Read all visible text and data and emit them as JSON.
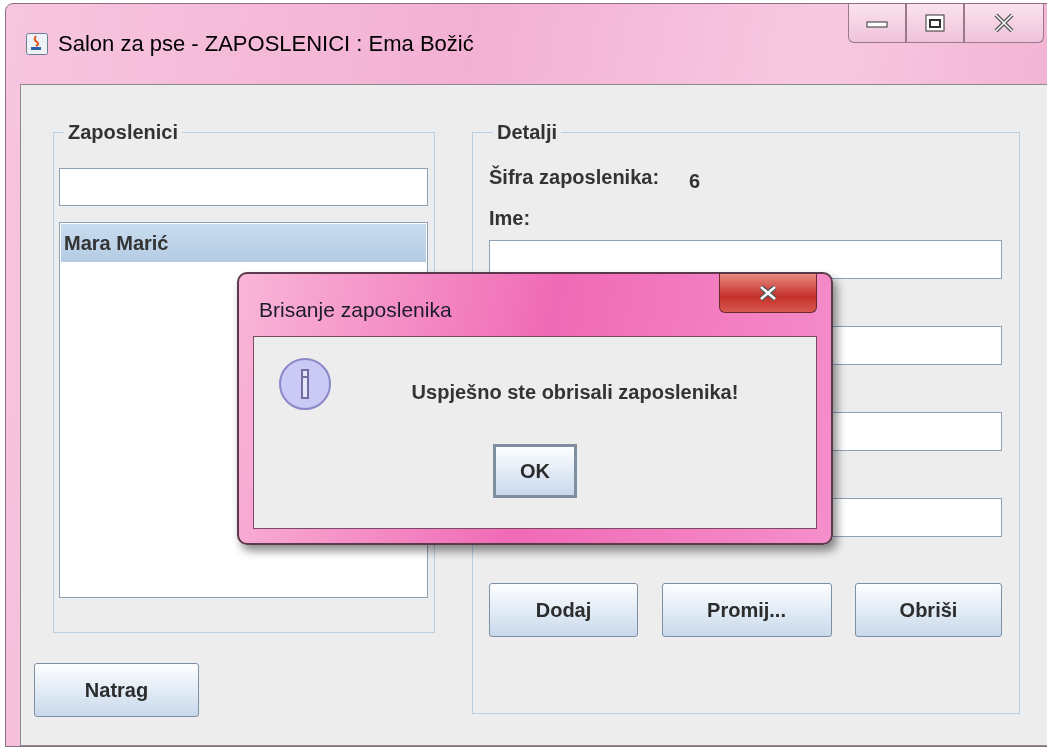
{
  "window": {
    "title": "Salon za pse - ZAPOSLENICI : Ema Božić"
  },
  "employees": {
    "title": "Zaposlenici",
    "items": [
      {
        "name": "Mara Marić",
        "selected": true
      }
    ]
  },
  "back_button": "Natrag",
  "details": {
    "title": "Detalji",
    "id_label": "Šifra zaposlenika:",
    "id_value": "6",
    "name_label": "Ime:",
    "buttons": [
      "Dodaj",
      "Promij...",
      "Obriši"
    ]
  },
  "dialog": {
    "title": "Brisanje zaposlenika",
    "message": "Uspješno ste obrisali zaposlenika!",
    "button": "OK"
  }
}
